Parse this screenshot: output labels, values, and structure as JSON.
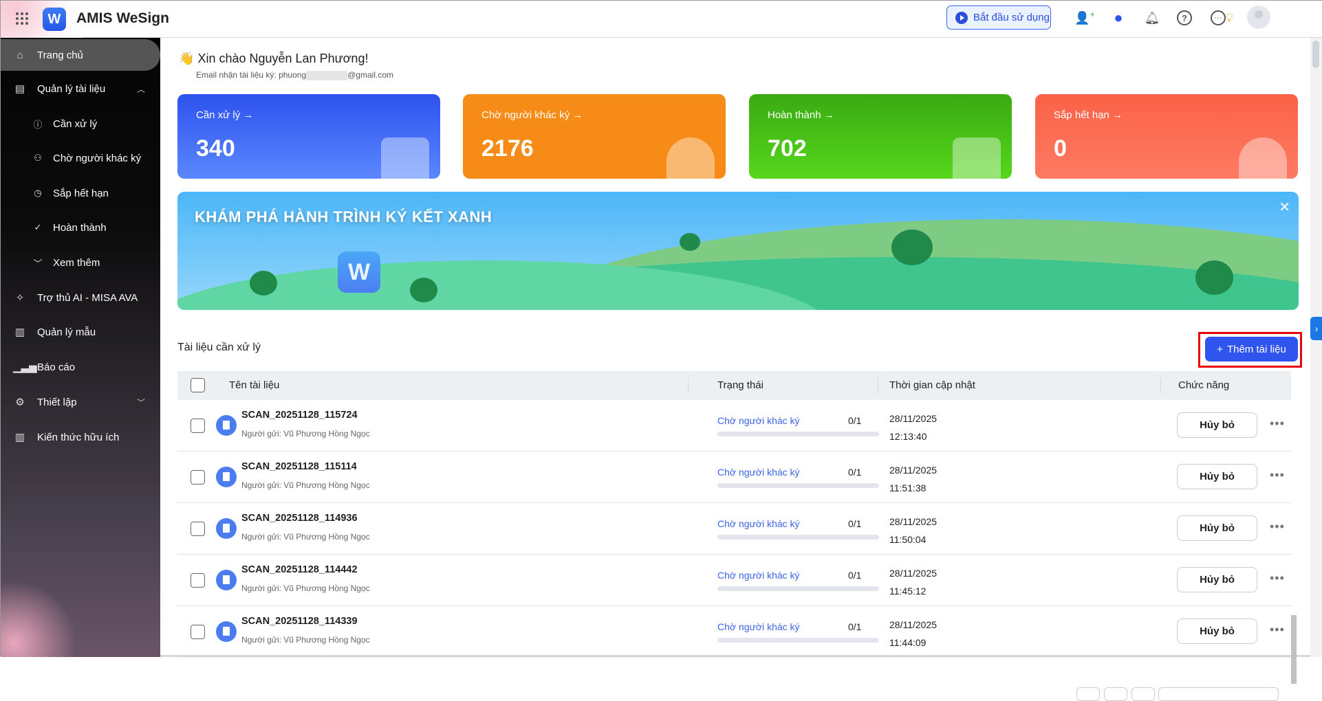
{
  "header": {
    "app_title": "AMIS WeSign",
    "logo_letter": "W",
    "start_button": "Bắt đầu sử dụng",
    "icons": [
      "add-user-icon",
      "chat-icon",
      "bell-icon",
      "help-icon",
      "more-icon",
      "lightbulb-book-icon",
      "avatar"
    ]
  },
  "sidebar": {
    "items": [
      {
        "label": "Trang chủ",
        "icon": "home-icon",
        "active": true
      },
      {
        "label": "Quản lý tài liệu",
        "icon": "document-icon",
        "expanded": true
      },
      {
        "label": "Cần xử lý",
        "icon": "alert-circle-icon",
        "sub": true
      },
      {
        "label": "Chờ người khác ký",
        "icon": "users-sign-icon",
        "sub": true
      },
      {
        "label": "Sắp hết hạn",
        "icon": "clock-icon",
        "sub": true
      },
      {
        "label": "Hoàn thành",
        "icon": "check-circle-icon",
        "sub": true
      },
      {
        "label": "Xem thêm",
        "icon": "chevron-down-icon",
        "sub": true
      },
      {
        "label": "Trợ thủ AI - MISA AVA",
        "icon": "magic-wand-icon"
      },
      {
        "label": "Quản lý mẫu",
        "icon": "template-icon"
      },
      {
        "label": "Báo cáo",
        "icon": "chart-icon"
      },
      {
        "label": "Thiết lập",
        "icon": "gear-icon",
        "expandable": true
      },
      {
        "label": "Kiến thức hữu ích",
        "icon": "book-icon"
      }
    ]
  },
  "greeting": {
    "text": "Xin chào Nguyễn Lan Phương!",
    "email_label": "Email nhận tài liệu ký:",
    "email_prefix": "phuong",
    "email_suffix": "@gmail.com"
  },
  "cards": [
    {
      "label": "Cần xử lý",
      "value": "340",
      "color": "#3a63f0"
    },
    {
      "label": "Chờ người khác ký",
      "value": "2176",
      "color": "#f78b17"
    },
    {
      "label": "Hoàn thành",
      "value": "702",
      "color": "#48c418"
    },
    {
      "label": "Sắp hết hạn",
      "value": "0",
      "color": "#fb6a55"
    }
  ],
  "banner": {
    "title": "KHÁM PHÁ HÀNH TRÌNH KÝ KẾT XANH",
    "logo_letter": "W",
    "close": "✕"
  },
  "section": {
    "title": "Tài liệu cần xử lý",
    "add_button": "Thêm tài liệu"
  },
  "table": {
    "headers": [
      "Tên tài liệu",
      "Trạng thái",
      "Thời gian cập nhật",
      "Chức năng"
    ],
    "rows": [
      {
        "name": "SCAN_20251128_115724",
        "sender": "Người gửi: Vũ Phương Hồng Ngọc",
        "status": "Chờ người khác ký",
        "ratio": "0/1",
        "progress": 0,
        "date": "28/11/2025",
        "time": "12:13:40",
        "action": "Hủy bỏ"
      },
      {
        "name": "SCAN_20251128_115114",
        "sender": "Người gửi: Vũ Phương Hồng Ngọc",
        "status": "Chờ người khác ký",
        "ratio": "0/1",
        "progress": 0,
        "date": "28/11/2025",
        "time": "11:51:38",
        "action": "Hủy bỏ"
      },
      {
        "name": "SCAN_20251128_114936",
        "sender": "Người gửi: Vũ Phương Hồng Ngọc",
        "status": "Chờ người khác ký",
        "ratio": "0/1",
        "progress": 0,
        "date": "28/11/2025",
        "time": "11:50:04",
        "action": "Hủy bỏ"
      },
      {
        "name": "SCAN_20251128_114442",
        "sender": "Người gửi: Vũ Phương Hồng Ngọc",
        "status": "Chờ người khác ký",
        "ratio": "0/1",
        "progress": 0,
        "date": "28/11/2025",
        "time": "11:45:12",
        "action": "Hủy bỏ"
      },
      {
        "name": "SCAN_20251128_114339",
        "sender": "Người gửi: Vũ Phương Hồng Ngọc",
        "status": "Chờ người khác ký",
        "ratio": "0/1",
        "progress": 0,
        "date": "28/11/2025",
        "time": "11:44:09",
        "action": "Hủy bỏ"
      }
    ]
  }
}
